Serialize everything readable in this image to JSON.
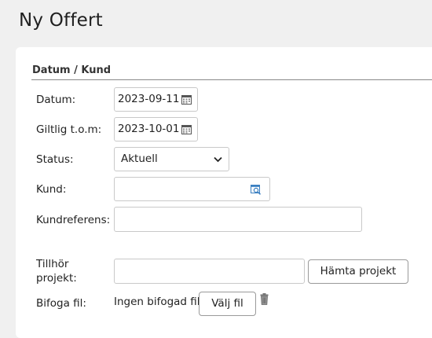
{
  "page": {
    "title": "Ny Offert"
  },
  "section": {
    "title": "Datum / Kund"
  },
  "form": {
    "datum": {
      "label": "Datum:",
      "value": "2023-09-11",
      "icon": "calendar-icon"
    },
    "giltlig": {
      "label": "Giltlig t.o.m:",
      "value": "2023-10-01",
      "icon": "calendar-icon"
    },
    "status": {
      "label": "Status:",
      "value": "Aktuell",
      "icon": "chevron-down-icon"
    },
    "kund": {
      "label": "Kund:",
      "value": "",
      "icon": "customer-search-icon"
    },
    "kundreferens": {
      "label": "Kundreferens:",
      "value": ""
    },
    "projekt": {
      "label_line1": "Tillhör",
      "label_line2": "projekt:",
      "value": "",
      "button": "Hämta projekt"
    },
    "bifoga": {
      "label": "Bifoga fil:",
      "no_file_text": "Ingen bifogad fil",
      "button": "Välj fil",
      "icon": "trash-icon"
    }
  }
}
